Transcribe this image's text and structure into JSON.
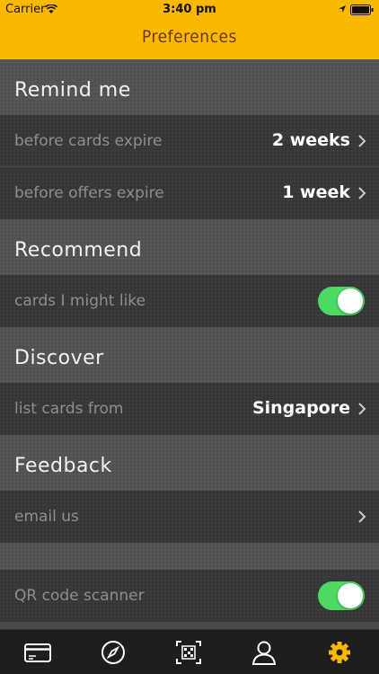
{
  "status_bar": {
    "carrier": "Carrier",
    "time": "3:40 pm"
  },
  "nav": {
    "title": "Preferences"
  },
  "sections": [
    {
      "title": "Remind me",
      "rows": [
        {
          "label": "before cards expire",
          "value": "2 weeks",
          "control": "chevron"
        },
        {
          "label": "before offers expire",
          "value": "1 week",
          "control": "chevron"
        }
      ]
    },
    {
      "title": "Recommend",
      "rows": [
        {
          "label": "cards I might like",
          "control": "toggle",
          "on": true
        }
      ]
    },
    {
      "title": "Discover",
      "rows": [
        {
          "label": "list cards from",
          "value": "Singapore",
          "control": "chevron"
        }
      ]
    },
    {
      "title": "Feedback",
      "rows": [
        {
          "label": "email us",
          "control": "chevron"
        }
      ]
    }
  ],
  "extra_rows": [
    {
      "label": "QR code scanner",
      "control": "toggle",
      "on": true
    }
  ],
  "tabbar": {
    "items": [
      "card-icon",
      "compass-icon",
      "qr-icon",
      "user-icon",
      "gear-icon"
    ],
    "active_index": 4,
    "active_color": "#fbb800",
    "inactive_color": "#ffffff"
  },
  "colors": {
    "accent": "#fbb800",
    "toggle_on": "#4cd964"
  }
}
